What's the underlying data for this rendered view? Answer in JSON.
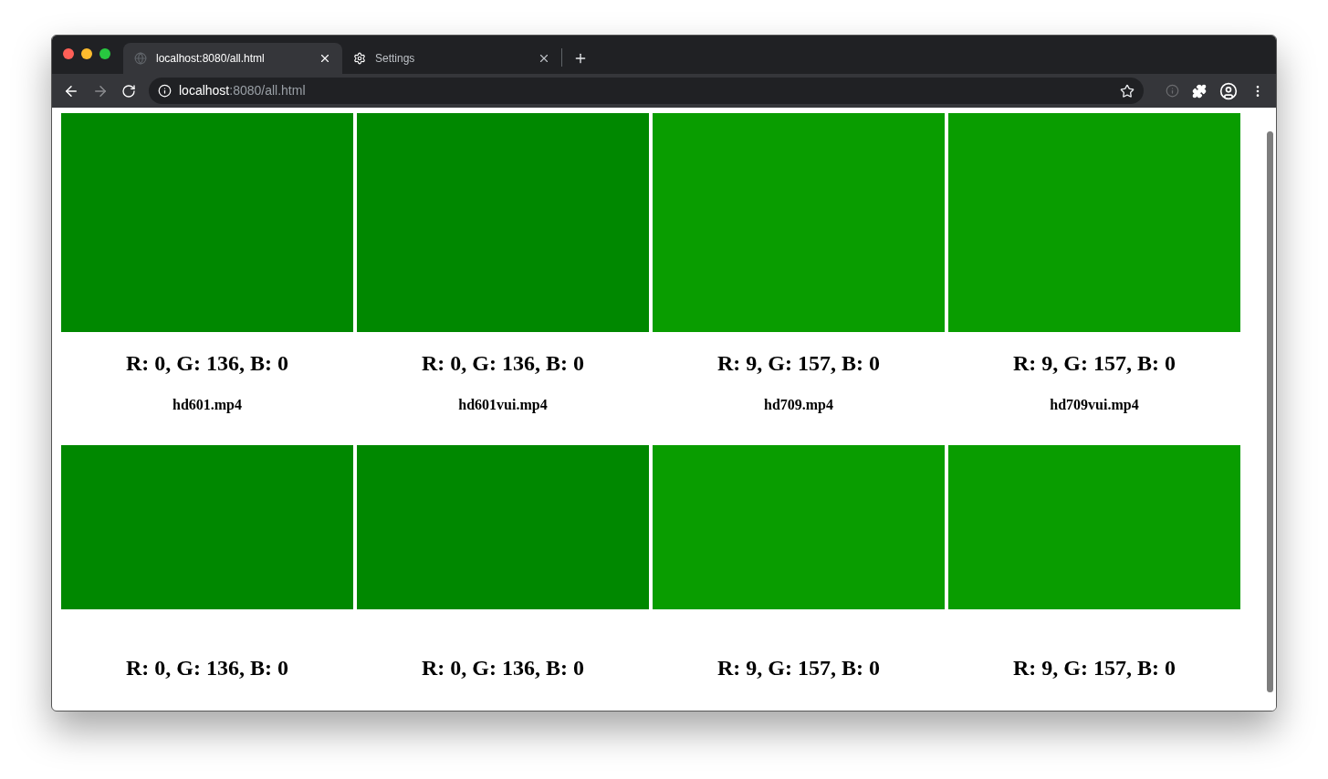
{
  "tabs": [
    {
      "title": "localhost:8080/all.html",
      "selected": true,
      "kind": "page"
    },
    {
      "title": "Settings",
      "selected": false,
      "kind": "settings"
    }
  ],
  "address_bar": {
    "host": "localhost",
    "path": ":8080/all.html"
  },
  "rows": [
    {
      "kind": "tall",
      "videos": [
        {
          "color": "#008800",
          "reading": "R: 0, G: 136, B: 0",
          "filename": "hd601.mp4"
        },
        {
          "color": "#008800",
          "reading": "R: 0, G: 136, B: 0",
          "filename": "hd601vui.mp4"
        },
        {
          "color": "#099d00",
          "reading": "R: 9, G: 157, B: 0",
          "filename": "hd709.mp4"
        },
        {
          "color": "#099d00",
          "reading": "R: 9, G: 157, B: 0",
          "filename": "hd709vui.mp4"
        }
      ]
    },
    {
      "kind": "short",
      "videos": [
        {
          "color": "#008800",
          "reading": "R: 0, G: 136, B: 0"
        },
        {
          "color": "#008800",
          "reading": "R: 0, G: 136, B: 0"
        },
        {
          "color": "#099d00",
          "reading": "R: 9, G: 157, B: 0"
        },
        {
          "color": "#099d00",
          "reading": "R: 9, G: 157, B: 0"
        }
      ]
    }
  ]
}
